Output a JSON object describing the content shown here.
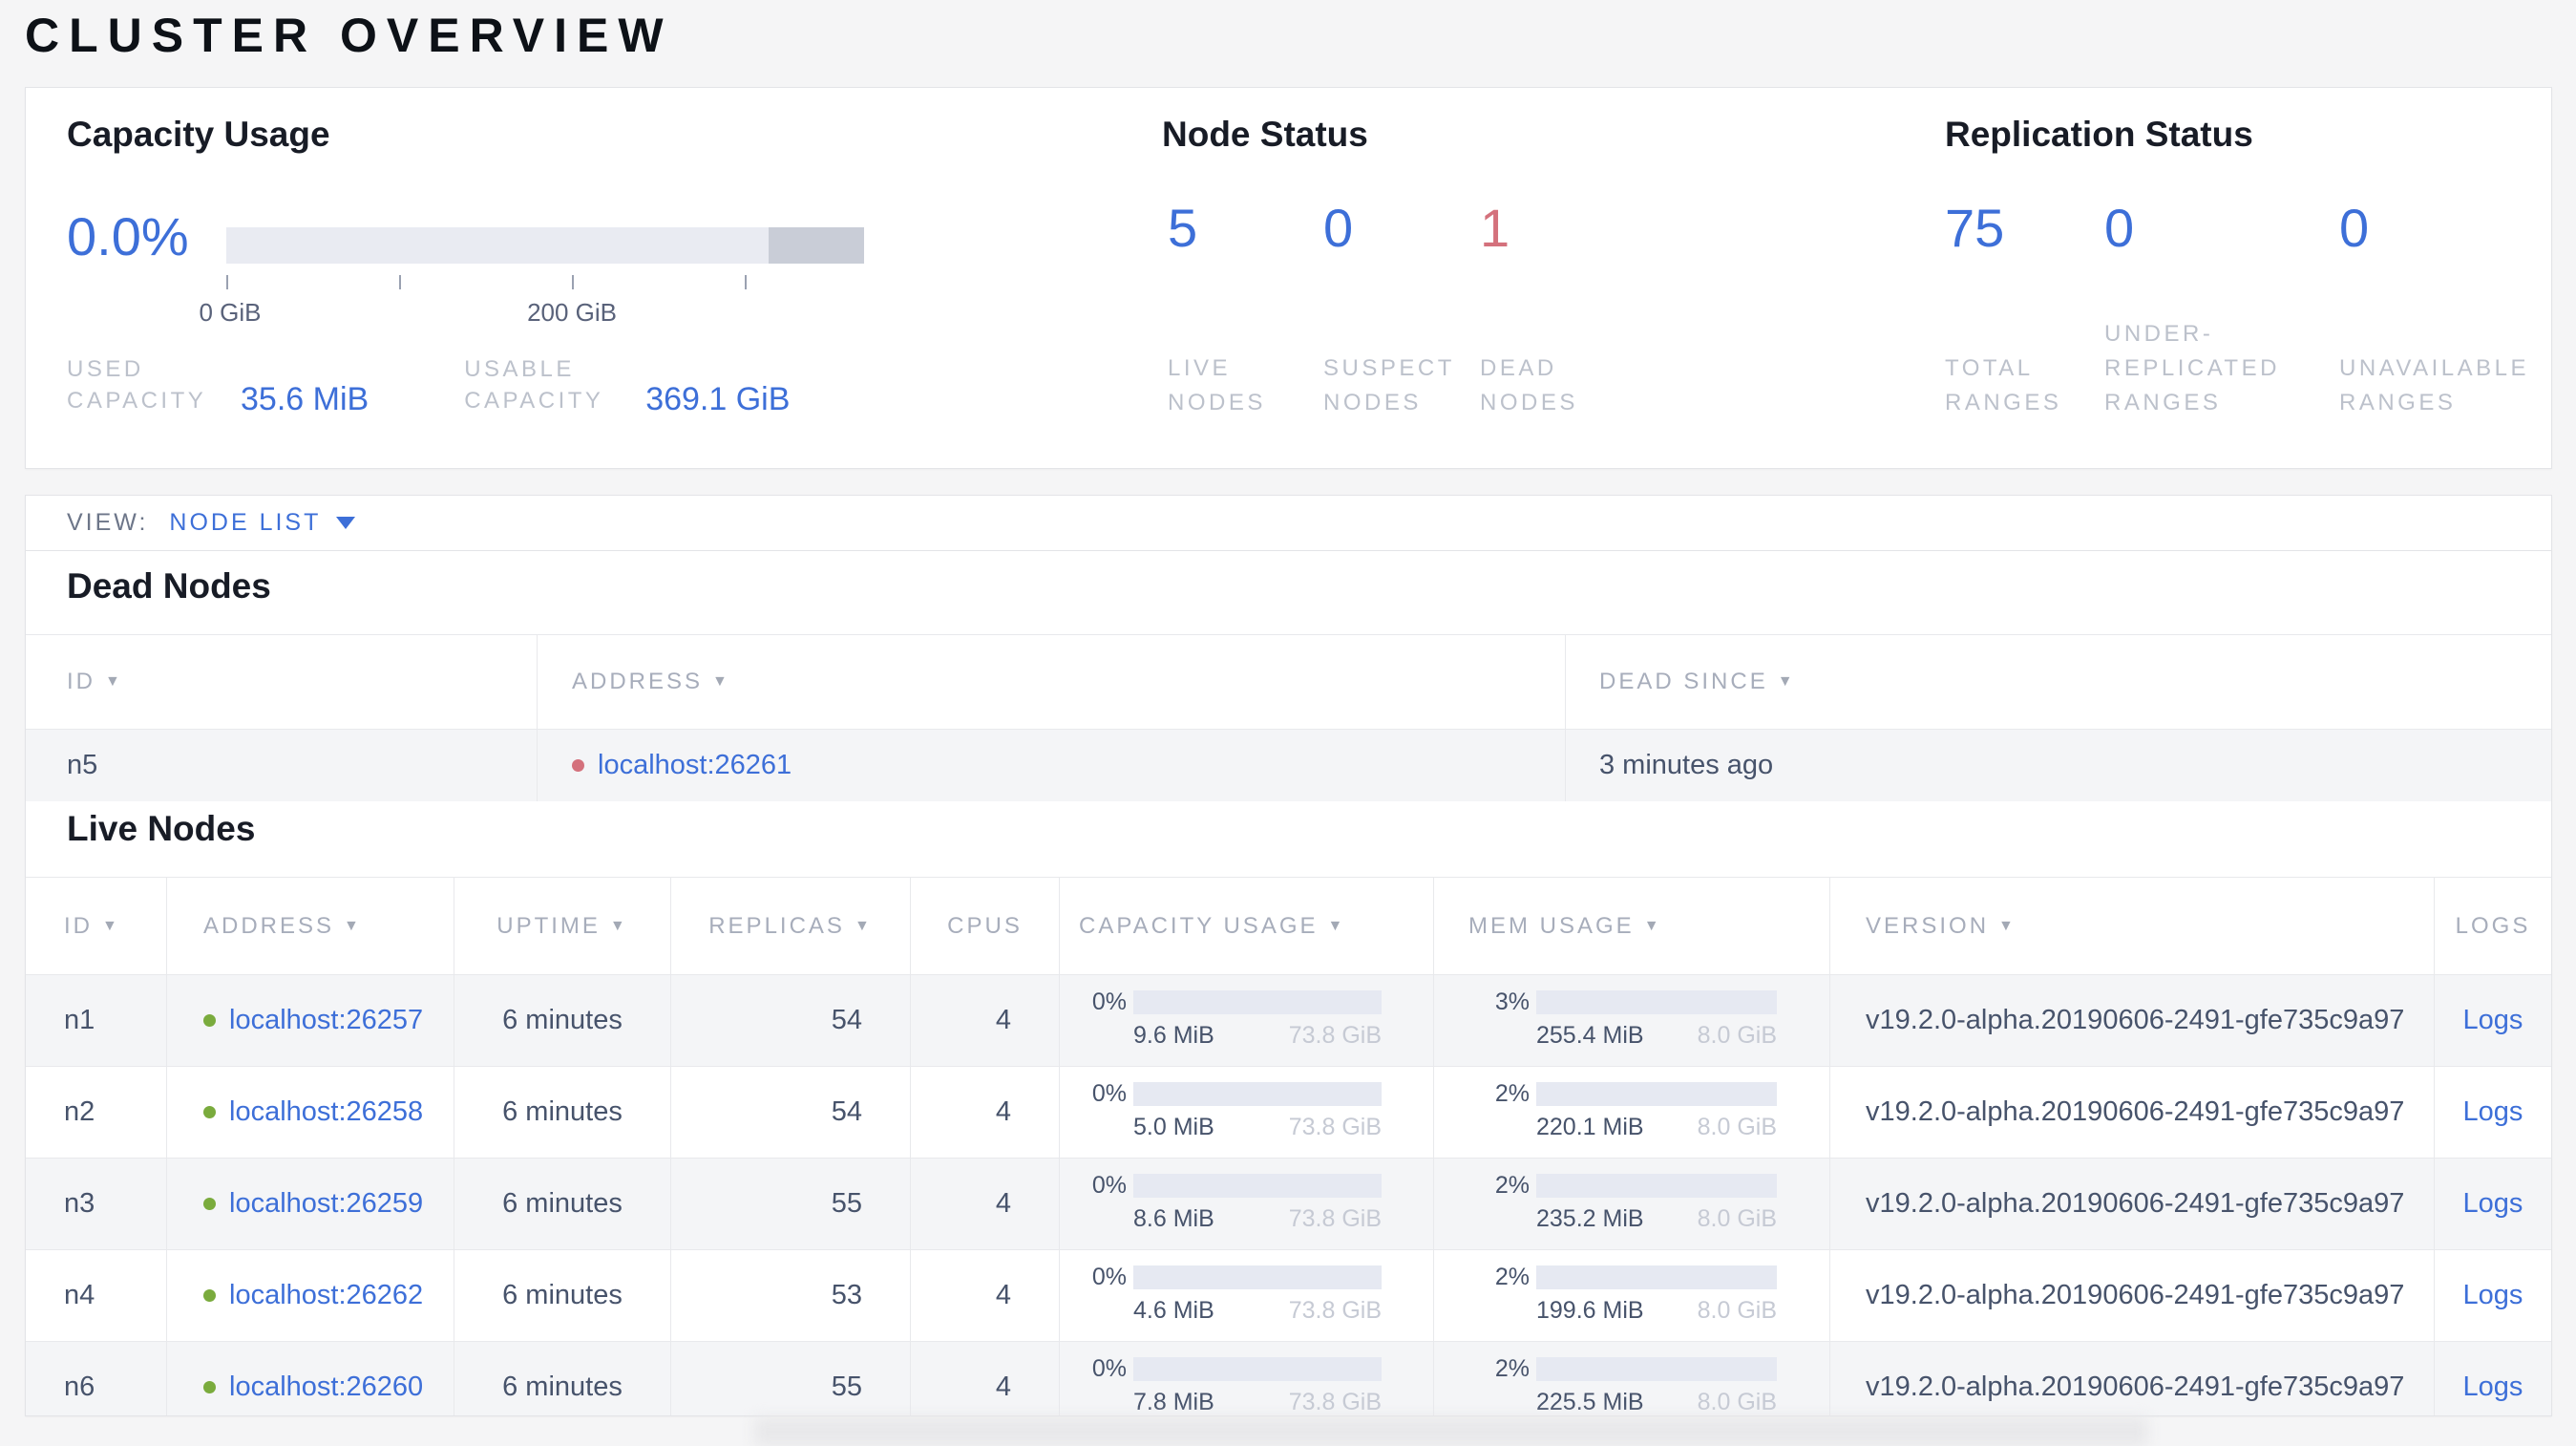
{
  "page": {
    "title": "CLUSTER OVERVIEW"
  },
  "colors": {
    "accent_blue": "#3d6fd8",
    "dead_red": "#d4717c",
    "live_green": "#7aab3d",
    "bar_track": "#e9ebf2",
    "bar_endcap": "#c9cdd7"
  },
  "icons": {
    "sort_desc": "▼"
  },
  "overview": {
    "capacity": {
      "title": "Capacity Usage",
      "percent": "0.0%",
      "tick_label_0": "0 GiB",
      "tick_label_200": "200 GiB",
      "used_label": "USED CAPACITY",
      "used_value": "35.6 MiB",
      "usable_label": "USABLE CAPACITY",
      "usable_value": "369.1 GiB"
    },
    "node_status": {
      "title": "Node Status",
      "live": {
        "value": "5",
        "label": "LIVE NODES"
      },
      "suspect": {
        "value": "0",
        "label": "SUSPECT NODES"
      },
      "dead": {
        "value": "1",
        "label": "DEAD NODES"
      }
    },
    "replication": {
      "title": "Replication Status",
      "total": {
        "value": "75",
        "label": "TOTAL RANGES"
      },
      "under_replicated": {
        "value": "0",
        "label": "UNDER-REPLICATED RANGES"
      },
      "unavailable": {
        "value": "0",
        "label": "UNAVAILABLE RANGES"
      }
    }
  },
  "view_bar": {
    "label": "VIEW:",
    "selected": "NODE LIST"
  },
  "dead_nodes": {
    "title": "Dead Nodes",
    "headers": {
      "id": "ID",
      "address": "ADDRESS",
      "dead_since": "DEAD SINCE"
    },
    "rows": [
      {
        "id": "n5",
        "address": "localhost:26261",
        "dead_since": "3 minutes ago"
      }
    ]
  },
  "live_nodes": {
    "title": "Live Nodes",
    "headers": {
      "id": "ID",
      "address": "ADDRESS",
      "uptime": "UPTIME",
      "replicas": "REPLICAS",
      "cpus": "CPUS",
      "capacity": "CAPACITY USAGE",
      "memory": "MEM USAGE",
      "version": "VERSION",
      "logs": "LOGS"
    },
    "rows": [
      {
        "id": "n1",
        "address": "localhost:26257",
        "uptime": "6 minutes",
        "replicas": "54",
        "cpus": "4",
        "cap_pct": "0%",
        "cap_used": "9.6 MiB",
        "cap_max": "73.8 GiB",
        "mem_pct": "3%",
        "mem_used": "255.4 MiB",
        "mem_max": "8.0 GiB",
        "version": "v19.2.0-alpha.20190606-2491-gfe735c9a97",
        "logs": "Logs"
      },
      {
        "id": "n2",
        "address": "localhost:26258",
        "uptime": "6 minutes",
        "replicas": "54",
        "cpus": "4",
        "cap_pct": "0%",
        "cap_used": "5.0 MiB",
        "cap_max": "73.8 GiB",
        "mem_pct": "2%",
        "mem_used": "220.1 MiB",
        "mem_max": "8.0 GiB",
        "version": "v19.2.0-alpha.20190606-2491-gfe735c9a97",
        "logs": "Logs"
      },
      {
        "id": "n3",
        "address": "localhost:26259",
        "uptime": "6 minutes",
        "replicas": "55",
        "cpus": "4",
        "cap_pct": "0%",
        "cap_used": "8.6 MiB",
        "cap_max": "73.8 GiB",
        "mem_pct": "2%",
        "mem_used": "235.2 MiB",
        "mem_max": "8.0 GiB",
        "version": "v19.2.0-alpha.20190606-2491-gfe735c9a97",
        "logs": "Logs"
      },
      {
        "id": "n4",
        "address": "localhost:26262",
        "uptime": "6 minutes",
        "replicas": "53",
        "cpus": "4",
        "cap_pct": "0%",
        "cap_used": "4.6 MiB",
        "cap_max": "73.8 GiB",
        "mem_pct": "2%",
        "mem_used": "199.6 MiB",
        "mem_max": "8.0 GiB",
        "version": "v19.2.0-alpha.20190606-2491-gfe735c9a97",
        "logs": "Logs"
      },
      {
        "id": "n6",
        "address": "localhost:26260",
        "uptime": "6 minutes",
        "replicas": "55",
        "cpus": "4",
        "cap_pct": "0%",
        "cap_used": "7.8 MiB",
        "cap_max": "73.8 GiB",
        "mem_pct": "2%",
        "mem_used": "225.5 MiB",
        "mem_max": "8.0 GiB",
        "version": "v19.2.0-alpha.20190606-2491-gfe735c9a97",
        "logs": "Logs"
      }
    ]
  }
}
